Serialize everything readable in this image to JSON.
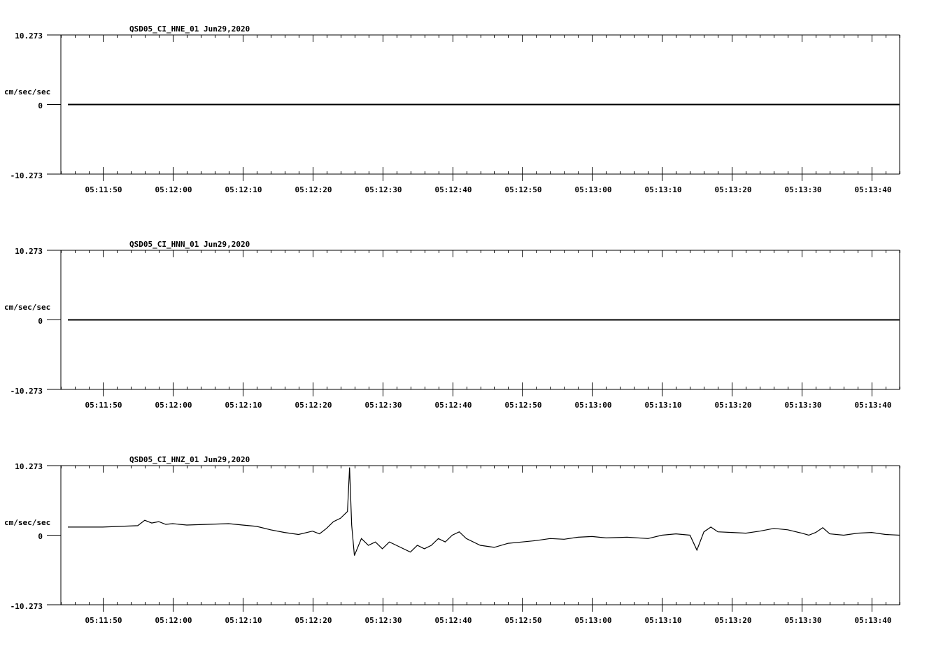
{
  "chart_data": [
    {
      "type": "line",
      "title": "QSD05_CI_HNE_01  Jun29,2020",
      "ylabel": "cm/sec/sec",
      "ylim": [
        -10.273,
        10.273
      ],
      "yticks": [
        "10.273",
        "0",
        "-10.273"
      ],
      "x_tick_labels": [
        "05:11:50",
        "05:12:00",
        "05:12:10",
        "05:12:20",
        "05:12:30",
        "05:12:40",
        "05:12:50",
        "05:13:00",
        "05:13:10",
        "05:13:20",
        "05:13:30",
        "05:13:40"
      ],
      "x_seconds_range": [
        -6,
        114
      ],
      "data_start_second": -5,
      "series": [
        {
          "values": [
            [
              -5,
              0
            ],
            [
              114,
              0
            ]
          ]
        }
      ]
    },
    {
      "type": "line",
      "title": "QSD05_CI_HNN_01  Jun29,2020",
      "ylabel": "cm/sec/sec",
      "ylim": [
        -10.273,
        10.273
      ],
      "yticks": [
        "10.273",
        "0",
        "-10.273"
      ],
      "x_tick_labels": [
        "05:11:50",
        "05:12:00",
        "05:12:10",
        "05:12:20",
        "05:12:30",
        "05:12:40",
        "05:12:50",
        "05:13:00",
        "05:13:10",
        "05:13:20",
        "05:13:30",
        "05:13:40"
      ],
      "x_seconds_range": [
        -6,
        114
      ],
      "series": [
        {
          "values": [
            [
              -5,
              0
            ],
            [
              114,
              0
            ]
          ]
        }
      ]
    },
    {
      "type": "line",
      "title": "QSD05_CI_HNZ_01  Jun29,2020",
      "ylabel": "cm/sec/sec",
      "ylim": [
        -10.273,
        10.273
      ],
      "yticks": [
        "10.273",
        "0",
        "-10.273"
      ],
      "x_tick_labels": [
        "05:11:50",
        "05:12:00",
        "05:12:10",
        "05:12:20",
        "05:12:30",
        "05:12:40",
        "05:12:50",
        "05:13:00",
        "05:13:10",
        "05:13:20",
        "05:13:30",
        "05:13:40"
      ],
      "x_seconds_range": [
        -6,
        114
      ],
      "series": [
        {
          "values": [
            [
              -5,
              1.2
            ],
            [
              0,
              1.2
            ],
            [
              5,
              1.4
            ],
            [
              6,
              2.2
            ],
            [
              7,
              1.8
            ],
            [
              8,
              2.0
            ],
            [
              9,
              1.6
            ],
            [
              10,
              1.7
            ],
            [
              12,
              1.5
            ],
            [
              15,
              1.6
            ],
            [
              18,
              1.7
            ],
            [
              20,
              1.5
            ],
            [
              22,
              1.3
            ],
            [
              24,
              0.8
            ],
            [
              26,
              0.4
            ],
            [
              28,
              0.1
            ],
            [
              30,
              0.6
            ],
            [
              31,
              0.2
            ],
            [
              32,
              1.0
            ],
            [
              33,
              2.0
            ],
            [
              34,
              2.5
            ],
            [
              35,
              3.5
            ],
            [
              35.3,
              10.0
            ],
            [
              35.6,
              1.5
            ],
            [
              36,
              -3.0
            ],
            [
              37,
              -0.5
            ],
            [
              38,
              -1.5
            ],
            [
              39,
              -1.0
            ],
            [
              40,
              -2.0
            ],
            [
              41,
              -1.0
            ],
            [
              42,
              -1.5
            ],
            [
              44,
              -2.5
            ],
            [
              45,
              -1.5
            ],
            [
              46,
              -2.0
            ],
            [
              47,
              -1.5
            ],
            [
              48,
              -0.5
            ],
            [
              49,
              -1.0
            ],
            [
              50,
              0.0
            ],
            [
              51,
              0.5
            ],
            [
              52,
              -0.5
            ],
            [
              54,
              -1.5
            ],
            [
              56,
              -1.8
            ],
            [
              58,
              -1.2
            ],
            [
              60,
              -1.0
            ],
            [
              62,
              -0.8
            ],
            [
              64,
              -0.5
            ],
            [
              66,
              -0.6
            ],
            [
              68,
              -0.3
            ],
            [
              70,
              -0.2
            ],
            [
              72,
              -0.4
            ],
            [
              75,
              -0.3
            ],
            [
              78,
              -0.5
            ],
            [
              80,
              0.0
            ],
            [
              82,
              0.2
            ],
            [
              84,
              0.0
            ],
            [
              85,
              -2.2
            ],
            [
              86,
              0.5
            ],
            [
              87,
              1.2
            ],
            [
              88,
              0.5
            ],
            [
              90,
              0.4
            ],
            [
              92,
              0.3
            ],
            [
              94,
              0.6
            ],
            [
              96,
              1.0
            ],
            [
              98,
              0.8
            ],
            [
              100,
              0.3
            ],
            [
              101,
              0.0
            ],
            [
              102,
              0.4
            ],
            [
              103,
              1.1
            ],
            [
              104,
              0.2
            ],
            [
              106,
              0.0
            ],
            [
              108,
              0.3
            ],
            [
              110,
              0.4
            ],
            [
              112,
              0.1
            ],
            [
              114,
              0.0
            ]
          ]
        }
      ]
    }
  ]
}
